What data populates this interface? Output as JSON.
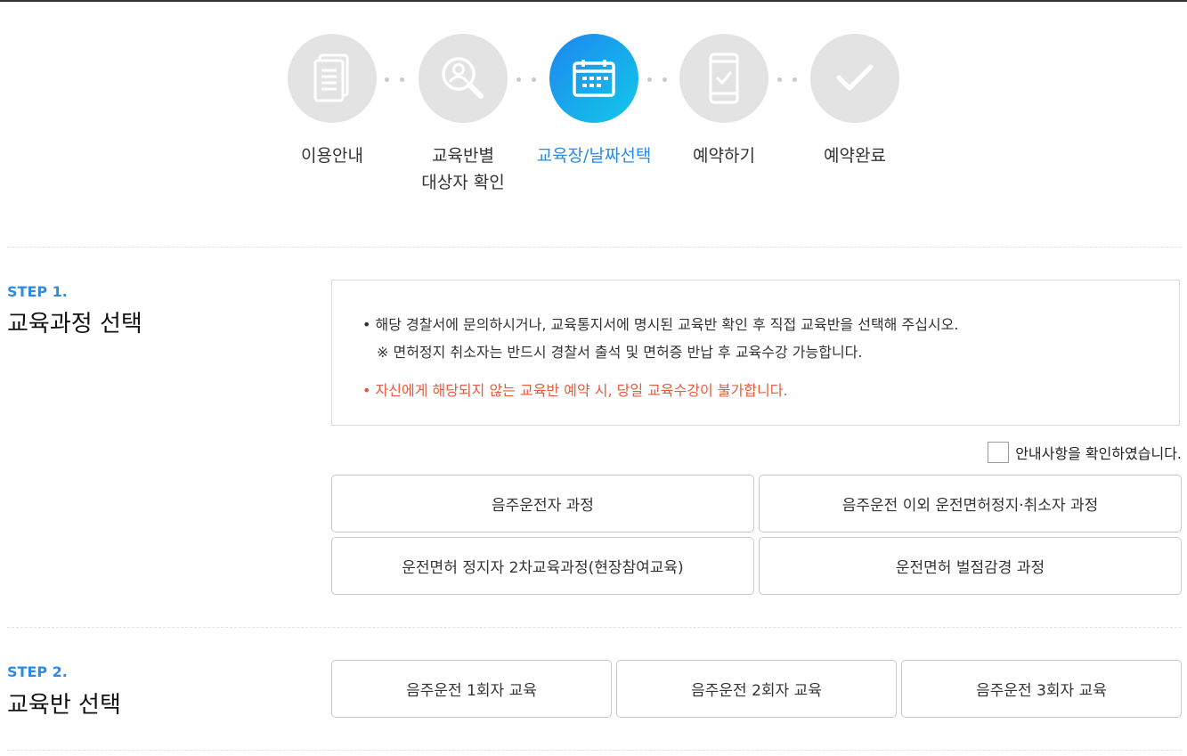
{
  "progress": {
    "steps": [
      {
        "label_line1": "이용안내",
        "label_line2": "",
        "icon": "document-icon",
        "active": false
      },
      {
        "label_line1": "교육반별",
        "label_line2": "대상자 확인",
        "icon": "search-person-icon",
        "active": false
      },
      {
        "label_line1": "교육장/날짜선택",
        "label_line2": "",
        "icon": "calendar-icon",
        "active": true
      },
      {
        "label_line1": "예약하기",
        "label_line2": "",
        "icon": "mobile-check-icon",
        "active": false
      },
      {
        "label_line1": "예약완료",
        "label_line2": "",
        "icon": "checkmark-icon",
        "active": false
      }
    ],
    "active_gradient": [
      "#1d86f0",
      "#13c9e8"
    ],
    "inactive_color": "#e3e3e3"
  },
  "step1": {
    "step_label": "STEP 1.",
    "title": "교육과정 선택",
    "notice": {
      "line1": "해당 경찰서에 문의하시거나, 교육통지서에 명시된 교육반 확인 후 직접 교육반을 선택해 주십시오.",
      "line2": "※ 면허정지 취소자는 반드시 경찰서 출석 및 면허증 반납 후 교육수강 가능합니다.",
      "line3": "자신에게 해당되지 않는 교육반 예약 시, 당일 교육수강이 불가합니다."
    },
    "agree_label": "안내사항을 확인하였습니다.",
    "agree_checked": false,
    "courses": [
      "음주운전자 과정",
      "음주운전 이외 운전면허정지·취소자 과정",
      "운전면허 정지자 2차교육과정(현장참여교육)",
      "운전면허 벌점감경 과정"
    ]
  },
  "step2": {
    "step_label": "STEP 2.",
    "title": "교육반 선택",
    "classes": [
      "음주운전 1회자 교육",
      "음주운전 2회자 교육",
      "음주운전 3회자 교육"
    ]
  },
  "colors": {
    "accent": "#2a8be8",
    "warning": "#e85a3c"
  }
}
